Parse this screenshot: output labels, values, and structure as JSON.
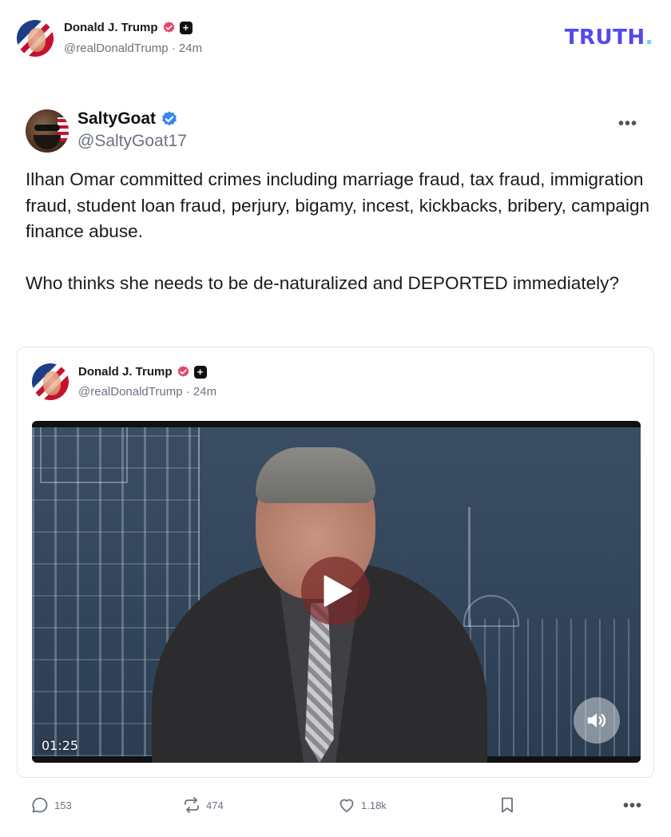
{
  "header": {
    "name": "Donald J. Trump",
    "handle": "@realDonaldTrump · 24m",
    "brand": "TRUTH",
    "brand_dot": ".",
    "brand_color": "#5448ee",
    "badges": [
      "verified-pink-icon",
      "plus-icon"
    ]
  },
  "post": {
    "author_name": "SaltyGoat",
    "author_handle": "@SaltyGoat17",
    "more_label": "•••",
    "text": "Ilhan Omar committed crimes including marriage fraud, tax fraud, immigration fraud, student loan fraud, perjury, bigamy, incest, kickbacks, bribery, campaign finance abuse.\n\nWho thinks she needs to be de-naturalized and DEPORTED immediately?"
  },
  "quote": {
    "name": "Donald J. Trump",
    "handle": "@realDonaldTrump · 24m",
    "video": {
      "duration": "01:25"
    }
  },
  "actions": {
    "replies": "153",
    "retruths": "474",
    "likes": "1.18k",
    "more_label": "•••"
  }
}
